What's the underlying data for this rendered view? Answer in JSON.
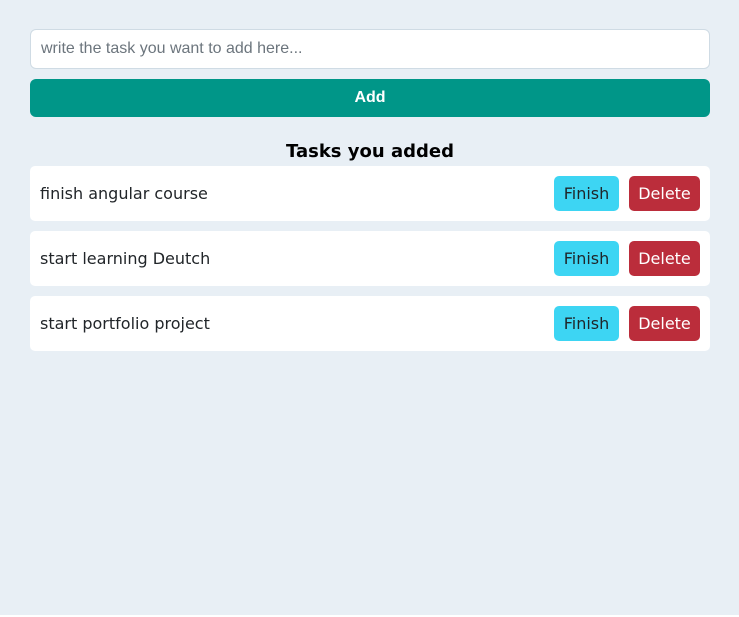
{
  "form": {
    "input_value": "",
    "input_placeholder": "write the task you want to add here...",
    "add_label": "Add"
  },
  "tasks_section": {
    "title": "Tasks you added",
    "finish_label": "Finish",
    "delete_label": "Delete",
    "items": [
      {
        "text": "finish angular course"
      },
      {
        "text": "start learning Deutch"
      },
      {
        "text": "start portfolio project"
      }
    ]
  },
  "colors": {
    "page_background": "#e8eff5",
    "add_button": "#009688",
    "finish_button": "#3dd5f3",
    "delete_button": "#bb2d3b"
  }
}
